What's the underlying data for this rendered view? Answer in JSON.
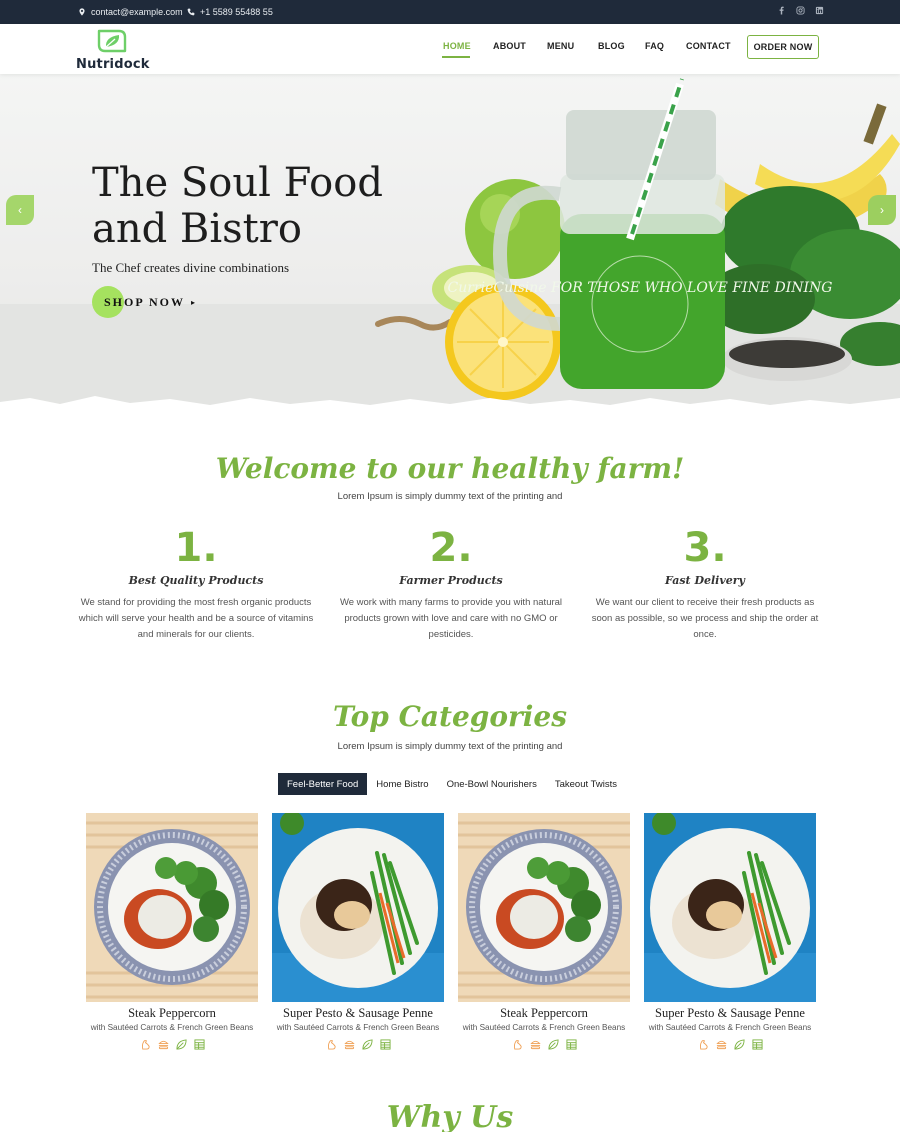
{
  "topbar": {
    "email": "contact@example.com",
    "phone": "+1 5589 55488 55",
    "social": [
      "facebook-icon",
      "instagram-icon",
      "linkedin-icon"
    ]
  },
  "header": {
    "logo_text": "Nutridock",
    "nav": [
      "HOME",
      "ABOUT",
      "MENU",
      "BLOG",
      "FAQ",
      "CONTACT"
    ],
    "active_nav": "HOME",
    "order_button": "ORDER NOW"
  },
  "hero": {
    "title_line1": "The Soul Food",
    "title_line2": "and Bistro",
    "subtitle": "The Chef creates divine combinations",
    "cta": "SHOP NOW",
    "jar_text": "CurrieCuisine FOR THOSE WHO LOVE FINE DINING",
    "slide_count": 3,
    "active_slide": 1
  },
  "welcome": {
    "title": "Welcome to our healthy farm!",
    "lead": "Lorem Ipsum is simply dummy text of the printing and",
    "features": [
      {
        "num": "1.",
        "title": "Best Quality Products",
        "desc": "We stand for providing the most fresh organic products which will serve your health and be a source of vitamins and minerals for our clients."
      },
      {
        "num": "2.",
        "title": "Farmer Products",
        "desc": "We work with many farms to provide you with natural products grown with love and care with no GMO or pesticides."
      },
      {
        "num": "3.",
        "title": "Fast Delivery",
        "desc": "We want our client to receive their fresh products as soon as possible, so we process and ship the order at once."
      }
    ]
  },
  "categories": {
    "title": "Top Categories",
    "lead": "Lorem Ipsum is simply dummy text of the printing and",
    "tabs": [
      "Feel-Better Food",
      "Home Bistro",
      "One-Bowl Nourishers",
      "Takeout Twists"
    ],
    "active_tab": "Feel-Better Food",
    "cards": [
      {
        "name": "Steak Peppercorn",
        "sub": "with Sautéed Carrots & French Green Beans"
      },
      {
        "name": "Super Pesto & Sausage Penne",
        "sub": "with Sautéed Carrots & French Green Beans"
      },
      {
        "name": "Steak Peppercorn",
        "sub": "with Sautéed Carrots & French Green Beans"
      },
      {
        "name": "Super Pesto & Sausage Penne",
        "sub": "with Sautéed Carrots & French Green Beans"
      }
    ],
    "card_icons": [
      "muscle-icon",
      "burger-icon",
      "leaf-icon",
      "nutrition-table-icon"
    ]
  },
  "why_us": {
    "title": "Why Us"
  },
  "colors": {
    "accent": "#7cb342",
    "dark": "#1f2a3a",
    "bright_green": "#a5e25f"
  }
}
